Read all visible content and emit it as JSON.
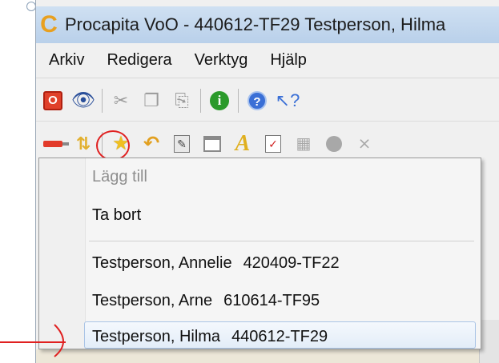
{
  "window": {
    "title": "Procapita VoO - 440612-TF29 Testperson, Hilma",
    "app_icon_letter": "C"
  },
  "menu": {
    "items": [
      "Arkiv",
      "Redigera",
      "Verktyg",
      "Hjälp"
    ]
  },
  "toolbar1": {
    "icons": [
      "stop-icon",
      "binoculars-icon",
      "cut-icon",
      "copy-icon",
      "paste-icon",
      "info-icon",
      "help-icon",
      "whats-this-icon"
    ]
  },
  "toolbar2": {
    "icons": [
      "red-list-icon",
      "sort-arrows-icon",
      "star-icon",
      "undo-icon",
      "edit-icon",
      "window-icon",
      "script-a-icon",
      "red-document-icon",
      "gray-grid-icon",
      "gray-circle-icon",
      "gray-chart-icon"
    ]
  },
  "dropdown": {
    "add_label": "Lägg till",
    "remove_label": "Ta bort",
    "persons": [
      {
        "name": "Testperson, Annelie",
        "pnr": "420409-TF22"
      },
      {
        "name": "Testperson, Arne",
        "pnr": "610614-TF95"
      },
      {
        "name": "Testperson, Hilma",
        "pnr": "440612-TF29"
      }
    ],
    "highlighted_index": 2
  },
  "colors": {
    "annotation": "#e02020",
    "titlebar": "#c4d8ee",
    "highlight": "#e3edf8"
  }
}
